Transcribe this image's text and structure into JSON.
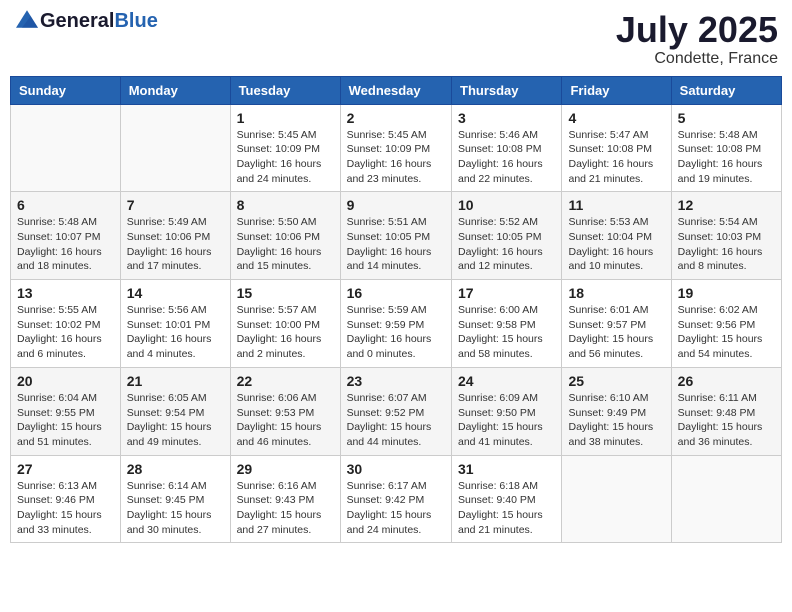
{
  "header": {
    "logo_general": "General",
    "logo_blue": "Blue",
    "month": "July 2025",
    "location": "Condette, France"
  },
  "weekdays": [
    "Sunday",
    "Monday",
    "Tuesday",
    "Wednesday",
    "Thursday",
    "Friday",
    "Saturday"
  ],
  "weeks": [
    [
      {
        "day": "",
        "info": ""
      },
      {
        "day": "",
        "info": ""
      },
      {
        "day": "1",
        "info": "Sunrise: 5:45 AM\nSunset: 10:09 PM\nDaylight: 16 hours\nand 24 minutes."
      },
      {
        "day": "2",
        "info": "Sunrise: 5:45 AM\nSunset: 10:09 PM\nDaylight: 16 hours\nand 23 minutes."
      },
      {
        "day": "3",
        "info": "Sunrise: 5:46 AM\nSunset: 10:08 PM\nDaylight: 16 hours\nand 22 minutes."
      },
      {
        "day": "4",
        "info": "Sunrise: 5:47 AM\nSunset: 10:08 PM\nDaylight: 16 hours\nand 21 minutes."
      },
      {
        "day": "5",
        "info": "Sunrise: 5:48 AM\nSunset: 10:08 PM\nDaylight: 16 hours\nand 19 minutes."
      }
    ],
    [
      {
        "day": "6",
        "info": "Sunrise: 5:48 AM\nSunset: 10:07 PM\nDaylight: 16 hours\nand 18 minutes."
      },
      {
        "day": "7",
        "info": "Sunrise: 5:49 AM\nSunset: 10:06 PM\nDaylight: 16 hours\nand 17 minutes."
      },
      {
        "day": "8",
        "info": "Sunrise: 5:50 AM\nSunset: 10:06 PM\nDaylight: 16 hours\nand 15 minutes."
      },
      {
        "day": "9",
        "info": "Sunrise: 5:51 AM\nSunset: 10:05 PM\nDaylight: 16 hours\nand 14 minutes."
      },
      {
        "day": "10",
        "info": "Sunrise: 5:52 AM\nSunset: 10:05 PM\nDaylight: 16 hours\nand 12 minutes."
      },
      {
        "day": "11",
        "info": "Sunrise: 5:53 AM\nSunset: 10:04 PM\nDaylight: 16 hours\nand 10 minutes."
      },
      {
        "day": "12",
        "info": "Sunrise: 5:54 AM\nSunset: 10:03 PM\nDaylight: 16 hours\nand 8 minutes."
      }
    ],
    [
      {
        "day": "13",
        "info": "Sunrise: 5:55 AM\nSunset: 10:02 PM\nDaylight: 16 hours\nand 6 minutes."
      },
      {
        "day": "14",
        "info": "Sunrise: 5:56 AM\nSunset: 10:01 PM\nDaylight: 16 hours\nand 4 minutes."
      },
      {
        "day": "15",
        "info": "Sunrise: 5:57 AM\nSunset: 10:00 PM\nDaylight: 16 hours\nand 2 minutes."
      },
      {
        "day": "16",
        "info": "Sunrise: 5:59 AM\nSunset: 9:59 PM\nDaylight: 16 hours\nand 0 minutes."
      },
      {
        "day": "17",
        "info": "Sunrise: 6:00 AM\nSunset: 9:58 PM\nDaylight: 15 hours\nand 58 minutes."
      },
      {
        "day": "18",
        "info": "Sunrise: 6:01 AM\nSunset: 9:57 PM\nDaylight: 15 hours\nand 56 minutes."
      },
      {
        "day": "19",
        "info": "Sunrise: 6:02 AM\nSunset: 9:56 PM\nDaylight: 15 hours\nand 54 minutes."
      }
    ],
    [
      {
        "day": "20",
        "info": "Sunrise: 6:04 AM\nSunset: 9:55 PM\nDaylight: 15 hours\nand 51 minutes."
      },
      {
        "day": "21",
        "info": "Sunrise: 6:05 AM\nSunset: 9:54 PM\nDaylight: 15 hours\nand 49 minutes."
      },
      {
        "day": "22",
        "info": "Sunrise: 6:06 AM\nSunset: 9:53 PM\nDaylight: 15 hours\nand 46 minutes."
      },
      {
        "day": "23",
        "info": "Sunrise: 6:07 AM\nSunset: 9:52 PM\nDaylight: 15 hours\nand 44 minutes."
      },
      {
        "day": "24",
        "info": "Sunrise: 6:09 AM\nSunset: 9:50 PM\nDaylight: 15 hours\nand 41 minutes."
      },
      {
        "day": "25",
        "info": "Sunrise: 6:10 AM\nSunset: 9:49 PM\nDaylight: 15 hours\nand 38 minutes."
      },
      {
        "day": "26",
        "info": "Sunrise: 6:11 AM\nSunset: 9:48 PM\nDaylight: 15 hours\nand 36 minutes."
      }
    ],
    [
      {
        "day": "27",
        "info": "Sunrise: 6:13 AM\nSunset: 9:46 PM\nDaylight: 15 hours\nand 33 minutes."
      },
      {
        "day": "28",
        "info": "Sunrise: 6:14 AM\nSunset: 9:45 PM\nDaylight: 15 hours\nand 30 minutes."
      },
      {
        "day": "29",
        "info": "Sunrise: 6:16 AM\nSunset: 9:43 PM\nDaylight: 15 hours\nand 27 minutes."
      },
      {
        "day": "30",
        "info": "Sunrise: 6:17 AM\nSunset: 9:42 PM\nDaylight: 15 hours\nand 24 minutes."
      },
      {
        "day": "31",
        "info": "Sunrise: 6:18 AM\nSunset: 9:40 PM\nDaylight: 15 hours\nand 21 minutes."
      },
      {
        "day": "",
        "info": ""
      },
      {
        "day": "",
        "info": ""
      }
    ]
  ]
}
